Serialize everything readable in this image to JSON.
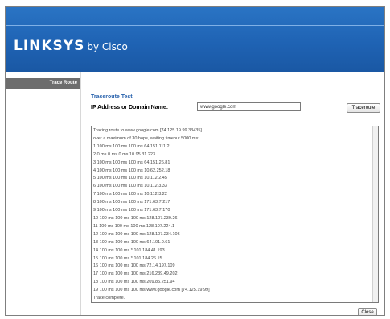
{
  "brand": {
    "name": "LINKSYS",
    "sub": "by Cisco"
  },
  "sidebar": {
    "items": [
      {
        "label": "Trace Route"
      }
    ]
  },
  "traceroute": {
    "title": "Traceroute Test",
    "ip_label": "IP Address or Domain Name:",
    "ip_value": "www.google.com",
    "button_label": "Traceroute",
    "close_label": "Close",
    "output_lines": [
      "Tracing route to www.google.com [74.125.19.99 33435]",
      "over a maximum of 30 hops, waiting timeout 5000 ms:",
      "1 100 ms 100 ms 100 ms 64.151.111.2",
      "2 0 ms 0 ms 0 ms 10.95.31.223",
      "3 100 ms 100 ms 100 ms 64.151.26.81",
      "4 100 ms 100 ms 100 ms 10.62.252.18",
      "5 100 ms 100 ms 100 ms 10.112.2.45",
      "6 100 ms 100 ms 100 ms 10.112.3.33",
      "7 100 ms 100 ms 100 ms 10.112.3.22",
      "8 100 ms 100 ms 100 ms 171.63.7.217",
      "9 100 ms 100 ms 100 ms 171.63.7.170",
      "10 100 ms 100 ms 100 ms 128.107.239.26",
      "11 100 ms 100 ms 100 ms 128.107.224.1",
      "12 100 ms 100 ms 100 ms 128.107.234.106",
      "13 100 ms 100 ms 100 ms 64.101.0.61",
      "14 100 ms 100 ms * 101.184.41.193",
      "15 100 ms 100 ms * 101.184.26.15",
      "16 100 ms 100 ms 100 ms 72.14.197.109",
      "17 100 ms 100 ms 100 ms 216.239.49.202",
      "18 100 ms 100 ms 100 ms 209.85.251.94",
      "19 100 ms 100 ms 100 ms www.google.com [74.125.19.99]",
      "Trace complete."
    ]
  },
  "colors": {
    "header_blue": "#1f63b4",
    "title_blue": "#2a63ad",
    "sidebar_gray": "#6d6d6d"
  }
}
